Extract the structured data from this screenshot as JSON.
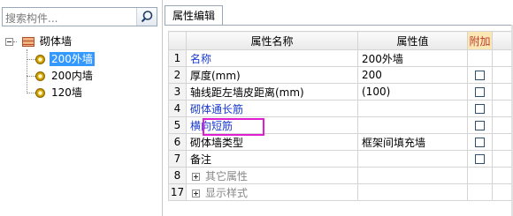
{
  "search": {
    "placeholder": "搜索构件..."
  },
  "tree": {
    "root_label": "砌体墙",
    "items": [
      {
        "label": "200外墙",
        "selected": true
      },
      {
        "label": "200内墙",
        "selected": false
      },
      {
        "label": "120墙",
        "selected": false
      }
    ]
  },
  "tab": {
    "label": "属性编辑"
  },
  "grid": {
    "headers": {
      "name": "属性名称",
      "value": "属性值",
      "extra": "附加"
    },
    "rows": [
      {
        "num": "1",
        "name": "名称",
        "value": "200外墙",
        "style": "blue",
        "checkbox": false
      },
      {
        "num": "2",
        "name": "厚度(mm)",
        "value": "200",
        "style": "normal",
        "checkbox": true
      },
      {
        "num": "3",
        "name": "轴线距左墙皮距离(mm)",
        "value": "(100)",
        "style": "normal",
        "checkbox": true
      },
      {
        "num": "4",
        "name": "砌体通长筋",
        "value": "",
        "style": "blue",
        "checkbox": true
      },
      {
        "num": "5",
        "name": "横向短筋",
        "value": "",
        "style": "blue",
        "checkbox": true
      },
      {
        "num": "6",
        "name": "砌体墙类型",
        "value": "框架间填充墙",
        "style": "normal",
        "checkbox": true
      },
      {
        "num": "7",
        "name": "备注",
        "value": "",
        "style": "normal",
        "checkbox": true
      },
      {
        "num": "8",
        "name": "其它属性",
        "value": "",
        "style": "group",
        "checkbox": false
      },
      {
        "num": "17",
        "name": "显示样式",
        "value": "",
        "style": "group",
        "checkbox": false
      }
    ]
  },
  "colors": {
    "highlight_box": "#e020d0",
    "selection": "#3399ff",
    "blue_text": "#1a3ad0"
  }
}
